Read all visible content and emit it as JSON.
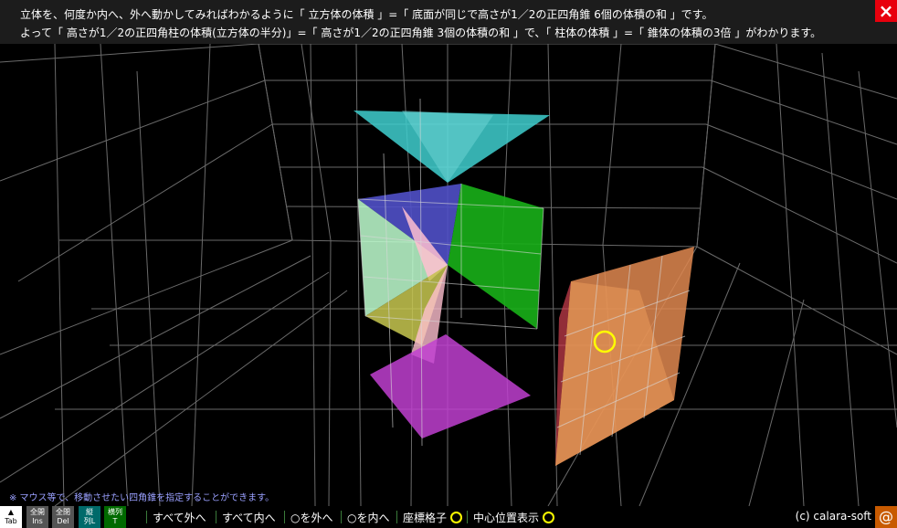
{
  "header": {
    "line1": "立体を、何度か内へ、外へ動かしてみればわかるように「 立方体の体積 」=「 底面が同じで高さが1／2の正四角錐 6個の体積の和 」です。",
    "line2": "よって「 高さが1／2の正四角柱の体積(立方体の半分)」=「 高さが1／2の正四角錐 3個の体積の和 」で、「 柱体の体積 」=「 錐体の体積の3倍 」がわかります。",
    "close_icon": "×"
  },
  "note": "※ マウス等で、移動させたい四角錐を指定することができます。",
  "toolbar": {
    "tab": {
      "top": "▲",
      "bottom": "Tab"
    },
    "open_all": {
      "top": "全開",
      "bottom": "Ins"
    },
    "close_all": {
      "top": "全閉",
      "bottom": "Del"
    },
    "vertical": {
      "top": "縦",
      "mid": "L",
      "bottom": "列"
    },
    "horizontal": {
      "top": "横列",
      "bottom": "T"
    },
    "all_out": "すべて外へ",
    "all_in": "すべて内へ",
    "circle_out": "○を外へ",
    "circle_in": "○を内へ",
    "grid": "座標格子",
    "center": "中心位置表示",
    "copyright": "(c) calara-soft",
    "at_icon": "@"
  },
  "colors": {
    "cyan": "#3fcfcf",
    "blue": "#5050c8",
    "green": "#18b018",
    "mint": "#c0ffd0",
    "pink": "#ffc0d0",
    "yellow": "#c8c850",
    "magenta": "#c040d0",
    "orange": "#e08850",
    "marker": "#ffff00"
  }
}
